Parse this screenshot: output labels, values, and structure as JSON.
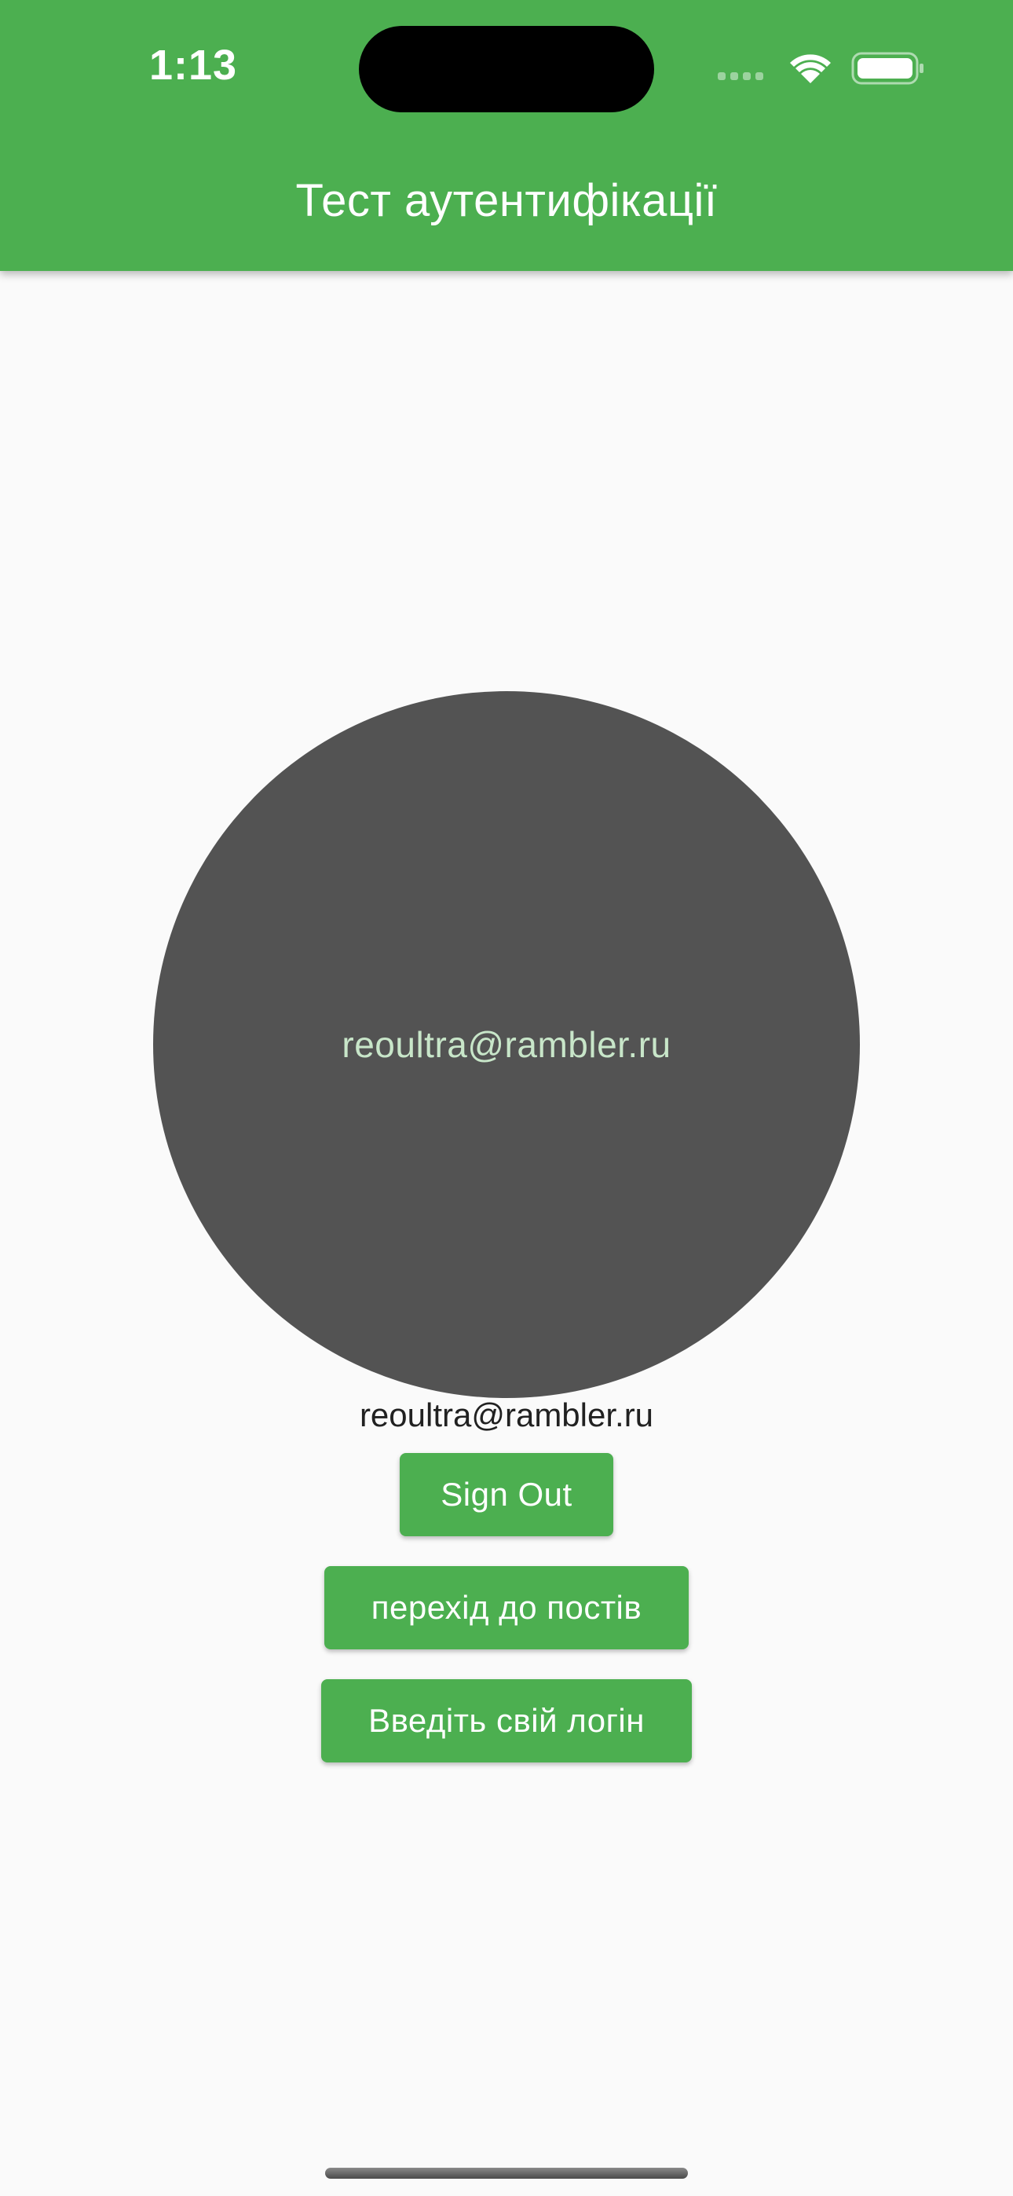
{
  "status_bar": {
    "time": "1:13",
    "icons": [
      "cellular-signal-icon",
      "wifi-icon",
      "battery-icon"
    ]
  },
  "app_bar": {
    "title": "Тест аутентифікації",
    "color": "#4caf50"
  },
  "profile": {
    "avatar_text": "reoultra@rambler.ru",
    "avatar_color": "#535353",
    "email": "reoultra@rambler.ru"
  },
  "actions": {
    "sign_out": "Sign Out",
    "go_to_posts": "перехід до постів",
    "enter_login": "Введіть свій логін"
  }
}
